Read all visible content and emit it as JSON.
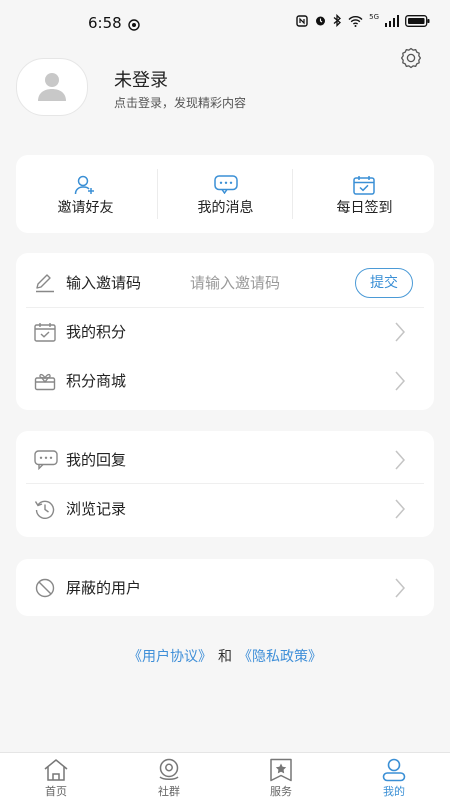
{
  "status_bar": {
    "time": "6:58",
    "network": "5G"
  },
  "profile": {
    "name": "未登录",
    "subtitle": "点击登录，发现精彩内容"
  },
  "quick_actions": [
    {
      "label": "邀请好友",
      "icon": "add-user-icon"
    },
    {
      "label": "我的消息",
      "icon": "message-icon"
    },
    {
      "label": "每日签到",
      "icon": "calendar-check-icon"
    }
  ],
  "invite": {
    "label": "输入邀请码",
    "placeholder": "请输入邀请码",
    "submit_label": "提交"
  },
  "menu_group1": [
    {
      "label": "我的积分",
      "icon": "points-calendar-icon"
    },
    {
      "label": "积分商城",
      "icon": "gift-box-icon"
    }
  ],
  "menu_group2": [
    {
      "label": "我的回复",
      "icon": "reply-bubble-icon"
    },
    {
      "label": "浏览记录",
      "icon": "history-clock-icon"
    }
  ],
  "menu_group3": [
    {
      "label": "屏蔽的用户",
      "icon": "block-icon"
    }
  ],
  "links": {
    "user_agreement": "《用户协议》",
    "and": "和",
    "privacy_policy": "《隐私政策》"
  },
  "tabs": [
    {
      "label": "首页",
      "icon": "home-icon",
      "active": false
    },
    {
      "label": "社群",
      "icon": "community-icon",
      "active": false
    },
    {
      "label": "服务",
      "icon": "bookmark-star-icon",
      "active": false
    },
    {
      "label": "我的",
      "icon": "user-icon",
      "active": true
    }
  ],
  "colors": {
    "accent": "#3a8fd5",
    "background": "#f6f6f6",
    "card": "#ffffff",
    "icon_gray": "#8a8a8a"
  }
}
